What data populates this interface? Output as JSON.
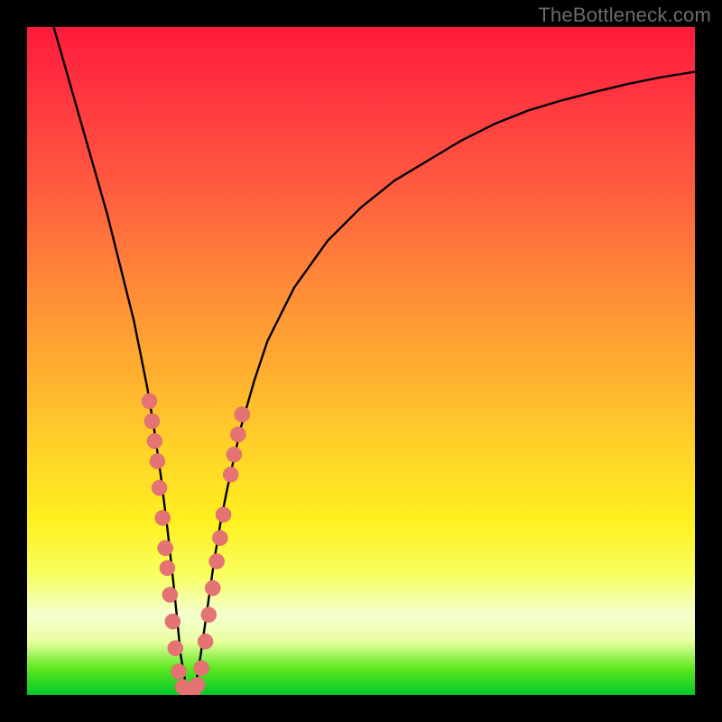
{
  "watermark": "TheBottleneck.com",
  "colors": {
    "frame": "#000000",
    "curve_stroke": "#000000",
    "marker_fill": "#e57373",
    "marker_stroke": "#d86a6a"
  },
  "chart_data": {
    "type": "line",
    "title": "",
    "xlabel": "",
    "ylabel": "",
    "xlim": [
      0,
      100
    ],
    "ylim": [
      0,
      100
    ],
    "grid": false,
    "legend": false,
    "series": [
      {
        "name": "bottleneck-curve",
        "x": [
          4,
          6,
          8,
          10,
          12,
          14,
          16,
          18,
          19,
          20,
          21,
          22,
          23,
          24,
          25,
          26,
          27,
          28,
          29,
          30,
          32,
          34,
          36,
          40,
          45,
          50,
          55,
          60,
          65,
          70,
          75,
          80,
          85,
          90,
          95,
          100
        ],
        "y": [
          100,
          93,
          86,
          79,
          72,
          64,
          56,
          46,
          40,
          33,
          25,
          16,
          6,
          0,
          0,
          6,
          13,
          20,
          26,
          31,
          40,
          47,
          53,
          61,
          68,
          73,
          77,
          80,
          83,
          85.5,
          87.5,
          89,
          90.3,
          91.5,
          92.5,
          93.3
        ]
      }
    ],
    "markers": [
      {
        "x": 18.3,
        "y": 44
      },
      {
        "x": 18.7,
        "y": 41
      },
      {
        "x": 19.1,
        "y": 38
      },
      {
        "x": 19.5,
        "y": 35
      },
      {
        "x": 19.8,
        "y": 31
      },
      {
        "x": 20.3,
        "y": 26.5
      },
      {
        "x": 20.7,
        "y": 22
      },
      {
        "x": 21.0,
        "y": 19
      },
      {
        "x": 21.4,
        "y": 15
      },
      {
        "x": 21.8,
        "y": 11
      },
      {
        "x": 22.2,
        "y": 7
      },
      {
        "x": 22.7,
        "y": 3.5
      },
      {
        "x": 23.3,
        "y": 1.2
      },
      {
        "x": 24.0,
        "y": 0.2
      },
      {
        "x": 24.8,
        "y": 0.2
      },
      {
        "x": 25.5,
        "y": 1.5
      },
      {
        "x": 26.1,
        "y": 4
      },
      {
        "x": 26.7,
        "y": 8
      },
      {
        "x": 27.2,
        "y": 12
      },
      {
        "x": 27.8,
        "y": 16
      },
      {
        "x": 28.4,
        "y": 20
      },
      {
        "x": 28.9,
        "y": 23.5
      },
      {
        "x": 29.4,
        "y": 27
      },
      {
        "x": 30.5,
        "y": 33
      },
      {
        "x": 31.0,
        "y": 36
      },
      {
        "x": 31.6,
        "y": 39
      },
      {
        "x": 32.2,
        "y": 42
      }
    ]
  }
}
